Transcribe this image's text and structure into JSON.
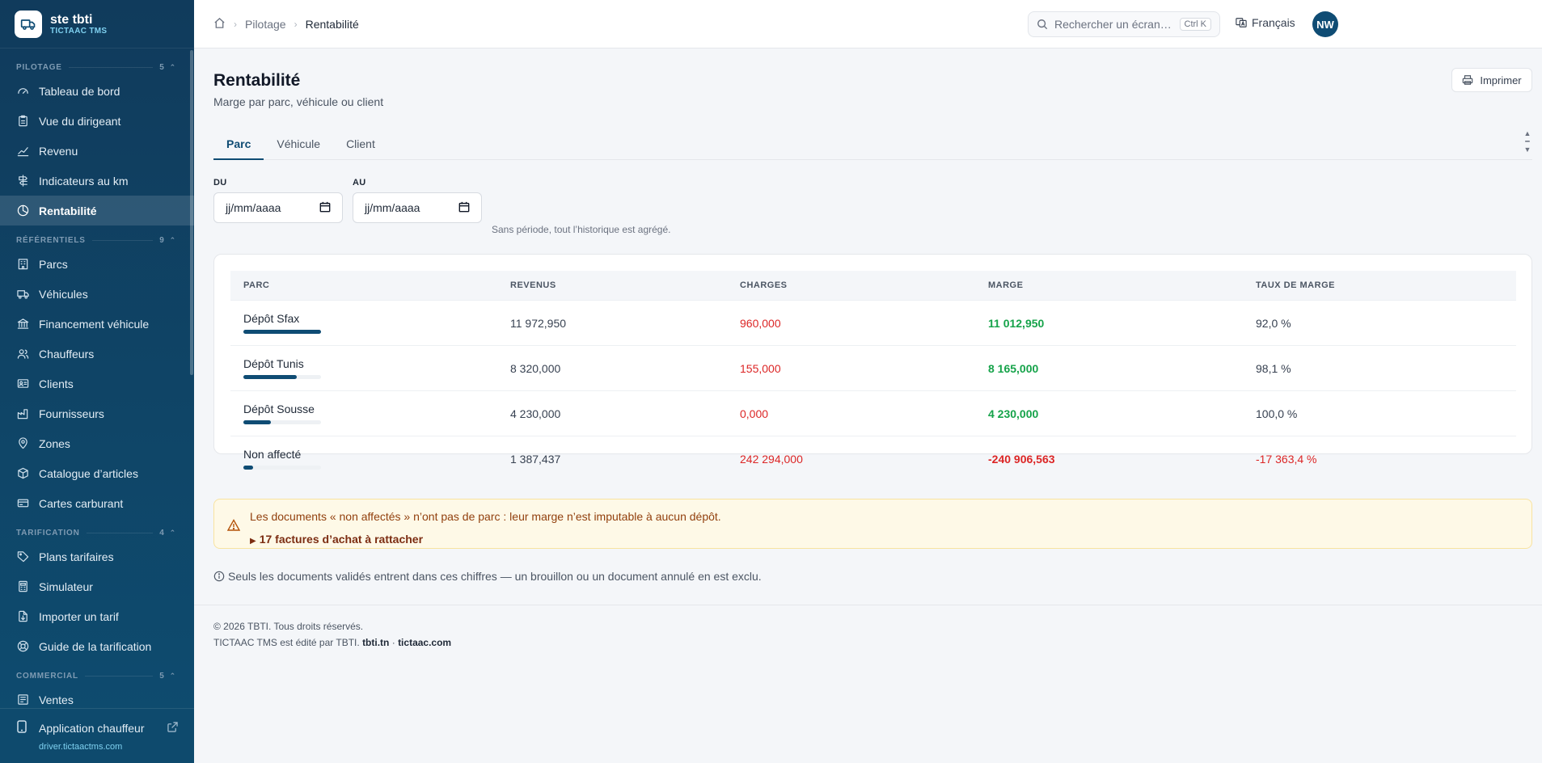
{
  "brand": {
    "name": "ste tbti",
    "product": "TICTAAC TMS"
  },
  "sidebar": {
    "sections": [
      {
        "title": "PILOTAGE",
        "count": "5",
        "items": [
          {
            "label": "Tableau de bord",
            "icon": "dashboard-icon"
          },
          {
            "label": "Vue du dirigeant",
            "icon": "clipboard-icon"
          },
          {
            "label": "Revenu",
            "icon": "trend-icon"
          },
          {
            "label": "Indicateurs au km",
            "icon": "signpost-icon"
          },
          {
            "label": "Rentabilité",
            "icon": "pie-icon",
            "active": true
          }
        ]
      },
      {
        "title": "RÉFÉRENTIELS",
        "count": "9",
        "items": [
          {
            "label": "Parcs",
            "icon": "building-icon"
          },
          {
            "label": "Véhicules",
            "icon": "truck-icon"
          },
          {
            "label": "Financement véhicule",
            "icon": "bank-icon"
          },
          {
            "label": "Chauffeurs",
            "icon": "users-icon"
          },
          {
            "label": "Clients",
            "icon": "id-card-icon"
          },
          {
            "label": "Fournisseurs",
            "icon": "factory-icon"
          },
          {
            "label": "Zones",
            "icon": "map-pin-icon"
          },
          {
            "label": "Catalogue d’articles",
            "icon": "box-icon"
          },
          {
            "label": "Cartes carburant",
            "icon": "card-icon"
          }
        ]
      },
      {
        "title": "TARIFICATION",
        "count": "4",
        "items": [
          {
            "label": "Plans tarifaires",
            "icon": "tag-icon"
          },
          {
            "label": "Simulateur",
            "icon": "calculator-icon"
          },
          {
            "label": "Importer un tarif",
            "icon": "file-import-icon"
          },
          {
            "label": "Guide de la tarification",
            "icon": "lifebuoy-icon"
          }
        ]
      },
      {
        "title": "COMMERCIAL",
        "count": "5",
        "items": [
          {
            "label": "Ventes",
            "icon": "sales-icon"
          }
        ]
      }
    ],
    "footer": {
      "label": "Application chauffeur",
      "url": "driver.tictaactms.com"
    }
  },
  "topbar": {
    "breadcrumb": [
      "Pilotage",
      "Rentabilité"
    ],
    "search_placeholder": "Rechercher un écran…",
    "search_shortcut": "Ctrl K",
    "language": "Français",
    "avatar_initials": "NW"
  },
  "page": {
    "title": "Rentabilité",
    "subtitle": "Marge par parc, véhicule ou client",
    "print_label": "Imprimer",
    "tabs": [
      "Parc",
      "Véhicule",
      "Client"
    ],
    "active_tab": "Parc",
    "filters": {
      "from_label": "DU",
      "to_label": "AU",
      "from_value": "jj/mm/aaaa",
      "to_value": "jj/mm/aaaa",
      "hint": "Sans période, tout l’historique est agrégé."
    }
  },
  "table": {
    "headers": [
      "PARC",
      "REVENUS",
      "CHARGES",
      "MARGE",
      "TAUX DE MARGE"
    ],
    "rows": [
      {
        "parc": "Dépôt Sfax",
        "share": 1.0,
        "revenus": "11 972,950",
        "charges": "960,000",
        "marge": "11 012,950",
        "taux": "92,0 %",
        "negative": false
      },
      {
        "parc": "Dépôt Tunis",
        "share": 0.69,
        "revenus": "8 320,000",
        "charges": "155,000",
        "marge": "8 165,000",
        "taux": "98,1 %",
        "negative": false
      },
      {
        "parc": "Dépôt Sousse",
        "share": 0.35,
        "revenus": "4 230,000",
        "charges": "0,000",
        "marge": "4 230,000",
        "taux": "100,0 %",
        "negative": false
      },
      {
        "parc": "Non affecté",
        "share": 0.12,
        "revenus": "1 387,437",
        "charges": "242 294,000",
        "marge": "-240 906,563",
        "taux": "-17 363,4 %",
        "negative": true
      }
    ]
  },
  "alert": {
    "message": "Les documents « non affectés » n’ont pas de parc : leur marge n’est imputable à aucun dépôt.",
    "details": "17 factures d’achat à rattacher"
  },
  "note": "Seuls les documents validés entrent dans ces chiffres — un brouillon ou un document annulé en est exclu.",
  "footer": {
    "copyright": "© 2026 TBTI. Tous droits réservés.",
    "edited_by": "TICTAAC TMS est édité par TBTI.",
    "link1": "tbti.tn",
    "link2": "tictaac.com"
  },
  "colors": {
    "primary": "#0f4c74",
    "positive": "#16a34a",
    "negative": "#dc2626",
    "warning_bg": "#fef9e7"
  }
}
